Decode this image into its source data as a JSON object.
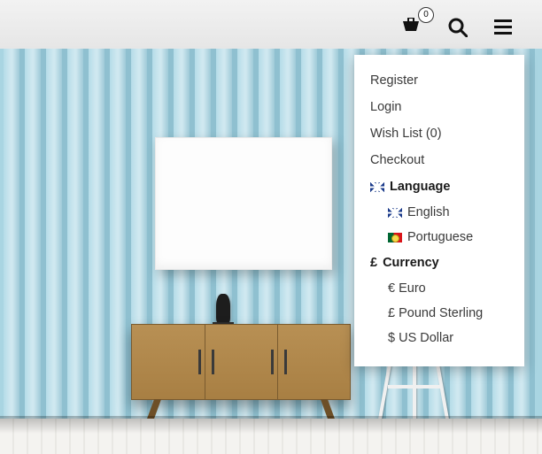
{
  "cart": {
    "count": "0"
  },
  "menu": {
    "register": "Register",
    "login": "Login",
    "wishlist": "Wish List (0)",
    "checkout": "Checkout",
    "language_label": "Language",
    "languages": {
      "en": "English",
      "pt": "Portuguese"
    },
    "currency_symbol": "£",
    "currency_label": "Currency",
    "currencies": {
      "eur": "€ Euro",
      "gbp": "£ Pound Sterling",
      "usd": "$ US Dollar"
    }
  }
}
